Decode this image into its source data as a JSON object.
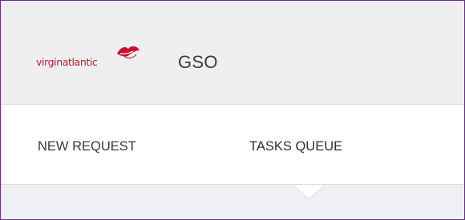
{
  "header": {
    "logo_text": "virginatlantic",
    "app_name": "GSO"
  },
  "nav": {
    "tabs": [
      {
        "label": "NEW REQUEST",
        "active": false
      },
      {
        "label": "TASKS QUEUE",
        "active": true
      }
    ]
  },
  "colors": {
    "frame_border": "#6a2d8a",
    "header_bg": "#efefef",
    "brand_red": "#c8102e",
    "content_bg": "#eef0f3"
  },
  "icons": {
    "logo_mark": "lips-icon",
    "active_tab_indicator": "caret-up-icon"
  }
}
